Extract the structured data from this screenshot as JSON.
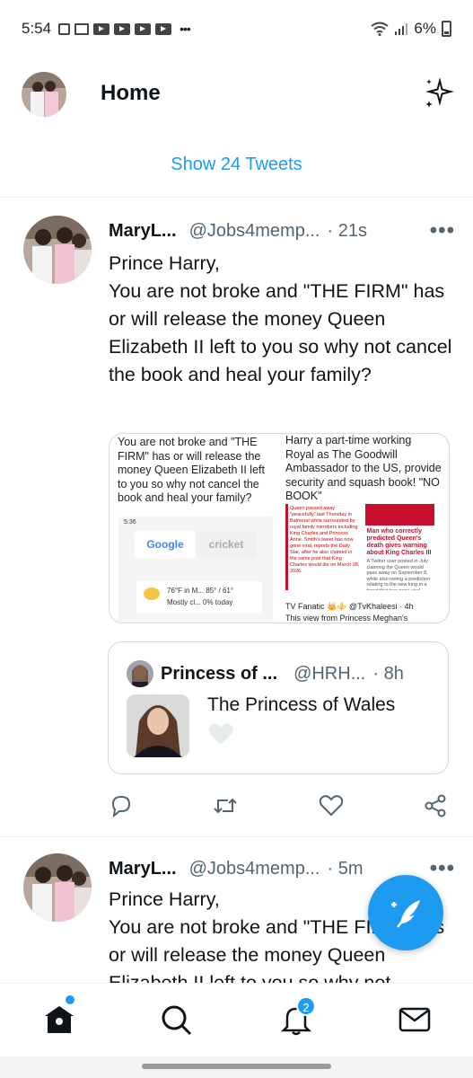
{
  "status_bar": {
    "time": "5:54",
    "battery": "6%"
  },
  "header": {
    "title": "Home"
  },
  "show_tweets": "Show 24 Tweets",
  "tweets": [
    {
      "name": "MaryL...",
      "handle": "@Jobs4memp...",
      "time": "· 21s",
      "text": "Prince Harry,\nYou are not broke and \"THE FIRM\" has or will release the money Queen Elizabeth II left to you so why not cancel the book and heal your family?",
      "media_left_text": "You are not broke and \"THE FIRM\" has or will release the money Queen Elizabeth II left to you so why not cancel the book and heal your family?",
      "media_left_phone": {
        "status": "5:36",
        "tab1": "Google",
        "tab2": "cricket",
        "weather_line1": "76°F in M...  85° / 61°",
        "weather_line2": "Mostly cl...  0% today"
      },
      "media_right_text": "Harry a part-time working Royal as The Goodwill Ambassador to the US, provide security and squash book! \"NO BOOK\"",
      "media_right_news_a": "Queen passed away \"peacefully\" last Thursday in Balmoral while surrounded by royal family members including King Charles and Princess Anne. Smith's tweet has now gone viral, reports the Daily Star, after he also claimed in the same post that King Charles would die on March 28, 2026.",
      "media_right_news_b_head": "Man who correctly predicted Queen's death gives warning about King Charles III",
      "media_right_news_b_body": "A Twitter user posted in July claiming the Queen would pass away on September 8, while also noting a prediction relating to the new king in a tweet that has gone viral",
      "media_right_foot1": "TV Fanatic 👑⚜️ @TvKhaleesi · 4h",
      "media_right_foot2": "This view from Princess Meghan's",
      "quote": {
        "name": "Princess of ...",
        "handle": "@HRH...",
        "time": "· 8h",
        "text": "The Princess of Wales"
      }
    },
    {
      "name": "MaryL...",
      "handle": "@Jobs4memp...",
      "time": "· 5m",
      "text": "Prince Harry,\nYou are not broke and \"THE FIRM\" has or will release the money Queen Elizabeth II left to you so why not"
    }
  ],
  "bottom_nav": {
    "notifications_badge": "2"
  },
  "colors": {
    "accent": "#1d9bf0",
    "text": "#0f1419",
    "secondary": "#536471"
  }
}
